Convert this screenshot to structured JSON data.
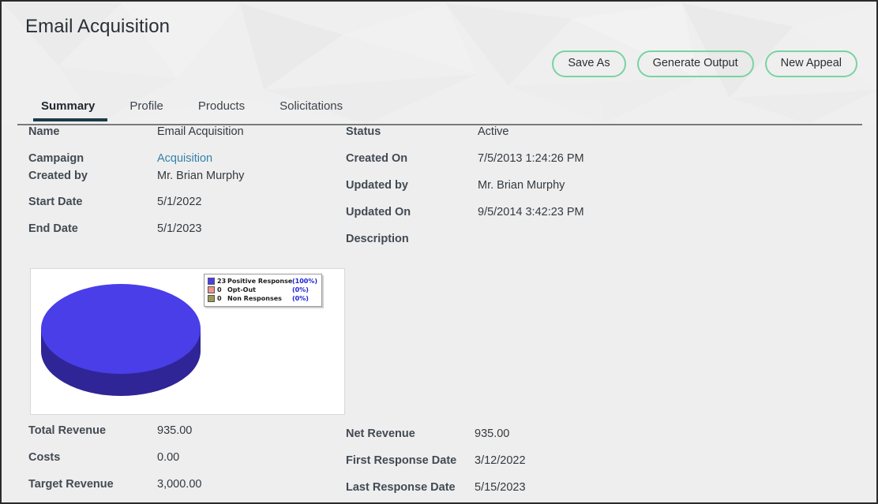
{
  "header": {
    "title": "Email Acquisition"
  },
  "toolbar": {
    "buttons": [
      {
        "label": "Save As",
        "name": "save-as-button"
      },
      {
        "label": "Generate Output",
        "name": "generate-output-button"
      },
      {
        "label": "New Appeal",
        "name": "new-appeal-button"
      }
    ],
    "border_color": "#79d3a1"
  },
  "tabs": {
    "items": [
      {
        "label": "Summary",
        "active": true
      },
      {
        "label": "Profile",
        "active": false
      },
      {
        "label": "Products",
        "active": false
      },
      {
        "label": "Solicitations",
        "active": false
      }
    ],
    "active_underline_color": "#1e3a47"
  },
  "summary": {
    "left_top": [
      {
        "label": "Name",
        "value": "Email Acquisition",
        "link": false
      },
      {
        "label": "Campaign",
        "value": "Acquisition",
        "link": true
      },
      {
        "label": "Created by",
        "value": "Mr. Brian Murphy",
        "link": false
      },
      {
        "label": "Start Date",
        "value": "5/1/2022",
        "link": false
      },
      {
        "label": "End Date",
        "value": "5/1/2023",
        "link": false
      }
    ],
    "right_top": [
      {
        "label": "Status",
        "value": "Active",
        "link": false
      },
      {
        "label": "Created On",
        "value": "7/5/2013 1:24:26 PM",
        "link": false
      },
      {
        "label": "Updated by",
        "value": "Mr. Brian Murphy",
        "link": false
      },
      {
        "label": "Updated On",
        "value": "9/5/2014 3:42:23 PM",
        "link": false
      },
      {
        "label": "Description",
        "value": "",
        "link": false
      }
    ],
    "left_bottom": [
      {
        "label": "Total Revenue",
        "value": "935.00"
      },
      {
        "label": "Costs",
        "value": "0.00"
      },
      {
        "label": "Target Revenue",
        "value": "3,000.00"
      }
    ],
    "right_bottom": [
      {
        "label": "Net Revenue",
        "value": "935.00"
      },
      {
        "label": "First Response Date",
        "value": "3/12/2022"
      },
      {
        "label": "Last Response Date",
        "value": "5/15/2023"
      }
    ],
    "link_color": "#3480ad"
  },
  "chart_data": {
    "type": "pie",
    "title": "",
    "legend_position": "top-right",
    "categories": [
      "Positive Response",
      "Opt-Out",
      "Non Responses"
    ],
    "values": [
      23,
      0,
      0
    ],
    "percents": [
      "(100%)",
      "(0%)",
      "(0%)"
    ],
    "counts": [
      "23",
      "0",
      "0"
    ],
    "colors": [
      "#4a3ee8",
      "#f1938c",
      "#9a9a54"
    ],
    "side_color": "#2f2596",
    "style": "3d-pie"
  }
}
